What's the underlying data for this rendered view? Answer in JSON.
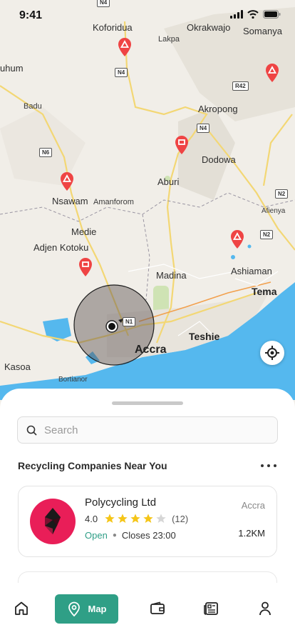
{
  "status_bar": {
    "time": "9:41"
  },
  "map": {
    "towns": [
      {
        "name": "Koforidua"
      },
      {
        "name": "Okrakwajo"
      },
      {
        "name": "Somanya"
      },
      {
        "name": "Lakpa"
      },
      {
        "name": "uhum"
      },
      {
        "name": "Badu"
      },
      {
        "name": "Akropong"
      },
      {
        "name": "Dodowa"
      },
      {
        "name": "Aburi"
      },
      {
        "name": "Nsawam"
      },
      {
        "name": "Amanforom"
      },
      {
        "name": "Medie"
      },
      {
        "name": "Afienya"
      },
      {
        "name": "Adjen Kotoku"
      },
      {
        "name": "Ashiaman"
      },
      {
        "name": "Madina"
      },
      {
        "name": "Tema"
      },
      {
        "name": "Teshie"
      },
      {
        "name": "Accra"
      },
      {
        "name": "Kasoa"
      },
      {
        "name": "Bortianor"
      }
    ],
    "road_shields": [
      "N4",
      "N4",
      "N4",
      "R42",
      "N6",
      "N2",
      "N2",
      "N1"
    ]
  },
  "search": {
    "placeholder": "Search"
  },
  "section": {
    "title": "Recycling Companies Near You"
  },
  "companies": [
    {
      "name": "Polycycling Ltd",
      "rating": "4.0",
      "rating_value": 4,
      "reviews": "(12)",
      "status": "Open",
      "closes": "Closes 23:00",
      "city": "Accra",
      "distance": "1.2KM",
      "brand_color": "#e91e58"
    }
  ],
  "nav": {
    "map_label": "Map",
    "accent": "#2f9f86"
  },
  "icons": [
    "home-icon",
    "map-pin-icon",
    "wallet-icon",
    "news-icon",
    "profile-icon",
    "locate-icon",
    "search-icon"
  ]
}
